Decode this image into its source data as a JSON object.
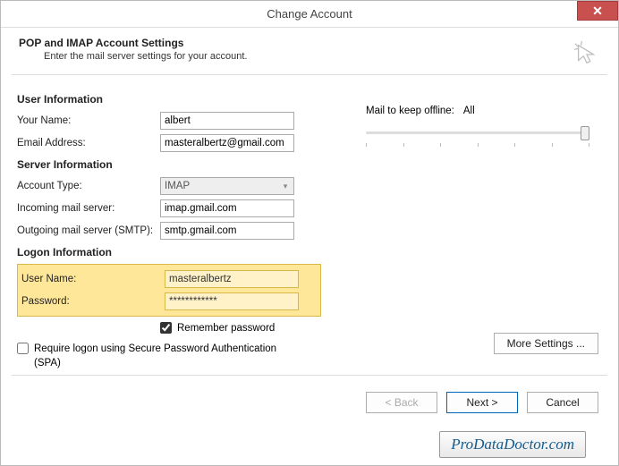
{
  "title": "Change Account",
  "header": {
    "title": "POP and IMAP Account Settings",
    "subtitle": "Enter the mail server settings for your account."
  },
  "sections": {
    "user_info": "User Information",
    "server_info": "Server Information",
    "logon_info": "Logon Information"
  },
  "labels": {
    "your_name": "Your Name:",
    "email": "Email Address:",
    "account_type": "Account Type:",
    "incoming": "Incoming mail server:",
    "outgoing": "Outgoing mail server (SMTP):",
    "user_name": "User Name:",
    "password": "Password:",
    "remember": "Remember password",
    "spa": "Require logon using Secure Password Authentication (SPA)",
    "offline": "Mail to keep offline:",
    "more_settings": "More Settings ...",
    "back": "< Back",
    "next": "Next >",
    "cancel": "Cancel"
  },
  "values": {
    "your_name": "albert",
    "email": "masteralbertz@gmail.com",
    "account_type": "IMAP",
    "incoming": "imap.gmail.com",
    "outgoing": "smtp.gmail.com",
    "user_name": "masteralbertz",
    "password": "************",
    "offline": "All"
  },
  "watermark": "ProDataDoctor.com"
}
